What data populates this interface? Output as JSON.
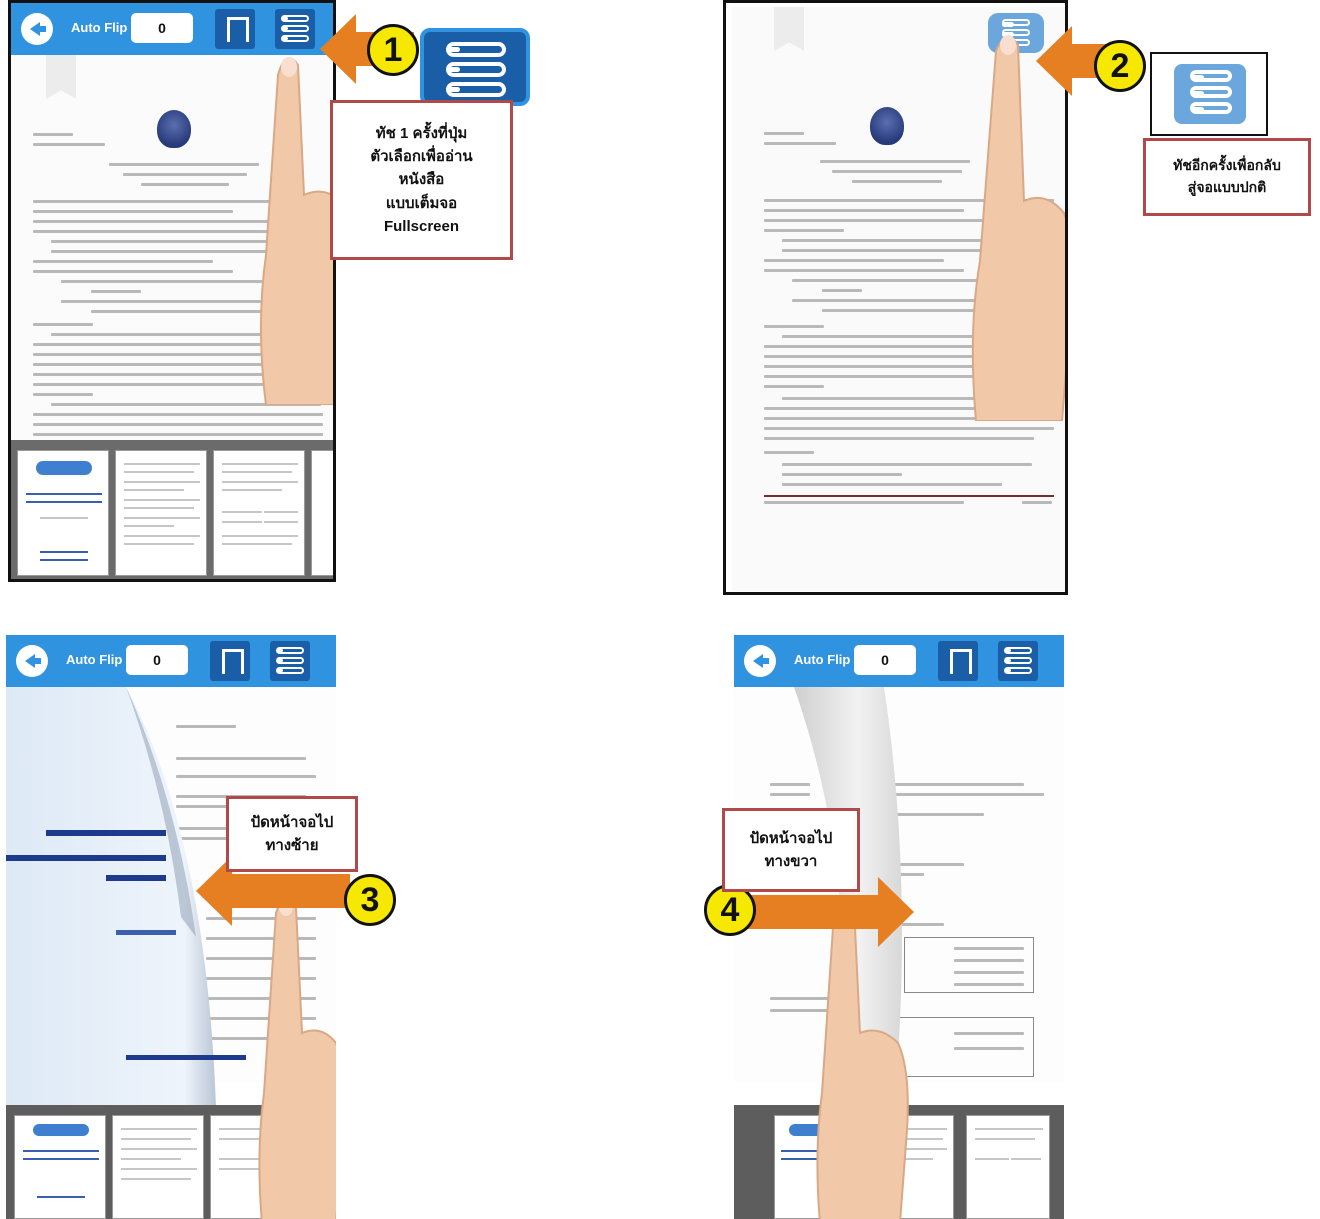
{
  "toolbar": {
    "back_icon": "back-arrow-icon",
    "auto_flip_label": "Auto Flip",
    "page_value": "0",
    "bookmark_icon": "bookmark-icon",
    "menu_icon": "list-menu-icon",
    "color": "#2f93e0"
  },
  "steps": [
    {
      "number": "1",
      "lines": [
        "ทัช 1 ครั้งที่ปุ่ม",
        "ตัวเลือกเพื่ออ่าน",
        "หนังสือ",
        "แบบเต็มจอ",
        "Fullscreen"
      ]
    },
    {
      "number": "2",
      "lines": [
        "ทัชอีกครั้งเพื่อกลับ",
        "สู่จอแบบปกติ"
      ]
    },
    {
      "number": "3",
      "lines": [
        "ปัดหน้าจอไป",
        "ทางซ้าย"
      ]
    },
    {
      "number": "4",
      "lines": [
        "ปัดหน้าจอไป",
        "ทางขวา"
      ]
    }
  ],
  "colors": {
    "callout_border": "#b04a4a",
    "step_badge": "#f6e800",
    "arrow": "#e67f22",
    "icon_bg": "#1a5ea8"
  }
}
